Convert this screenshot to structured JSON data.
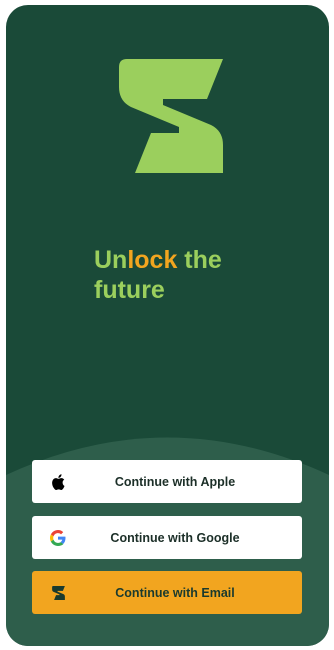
{
  "headline": {
    "part1": "Un",
    "accent": "lock",
    "part2": " the",
    "line2": "future"
  },
  "buttons": {
    "apple": {
      "label": "Continue with Apple",
      "icon": "apple-icon"
    },
    "google": {
      "label": "Continue with Google",
      "icon": "google-icon"
    },
    "email": {
      "label": "Continue with Email",
      "icon": "brand-s-icon"
    }
  },
  "colors": {
    "background": "#1a4a38",
    "wave": "#2e5e4b",
    "brand_green": "#9bcf5d",
    "accent_orange": "#f2a51f",
    "button_white": "#ffffff"
  }
}
